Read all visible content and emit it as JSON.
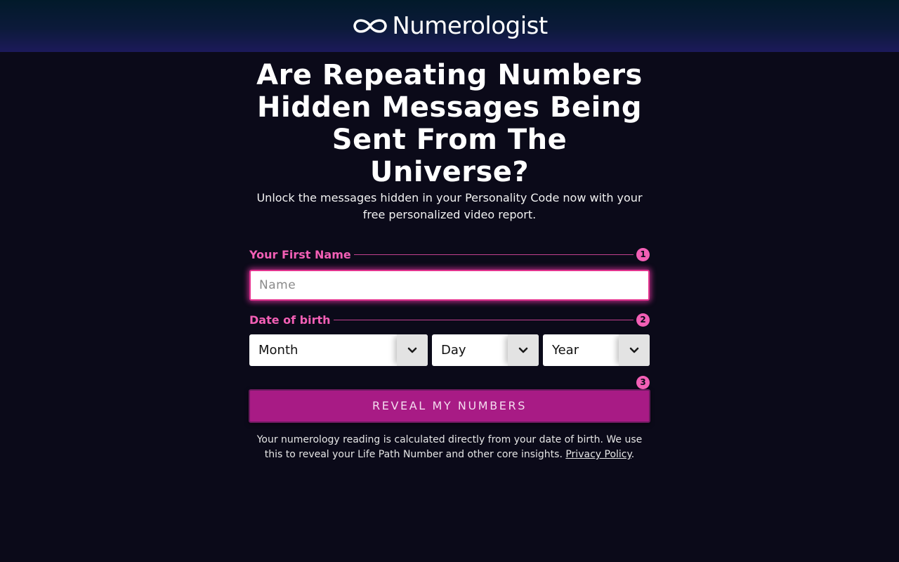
{
  "header": {
    "brand": "Numerologist",
    "logo_icon": "infinity-icon"
  },
  "hero": {
    "headline": "Are Repeating Numbers Hidden Messages Being Sent From The Universe?",
    "subhead": "Unlock the messages hidden in your Personality Code now with your free personalized video report."
  },
  "form": {
    "step1": {
      "label": "Your First Name",
      "number": "1"
    },
    "name_input": {
      "value": "",
      "placeholder": "Name"
    },
    "step2": {
      "label": "Date of birth",
      "number": "2"
    },
    "month": {
      "value": "Month"
    },
    "day": {
      "value": "Day"
    },
    "year": {
      "value": "Year"
    },
    "step3": {
      "number": "3"
    },
    "submit_label": "REVEAL MY NUMBERS"
  },
  "disclaimer": {
    "text": "Your numerology reading is calculated directly from your date of birth. We use this to reveal your Life Path Number and other core insights. ",
    "link_label": "Privacy Policy",
    "suffix": "."
  },
  "colors": {
    "background": "#0b0a19",
    "accent_pink": "#f25fb5",
    "button": "#a81b85"
  }
}
